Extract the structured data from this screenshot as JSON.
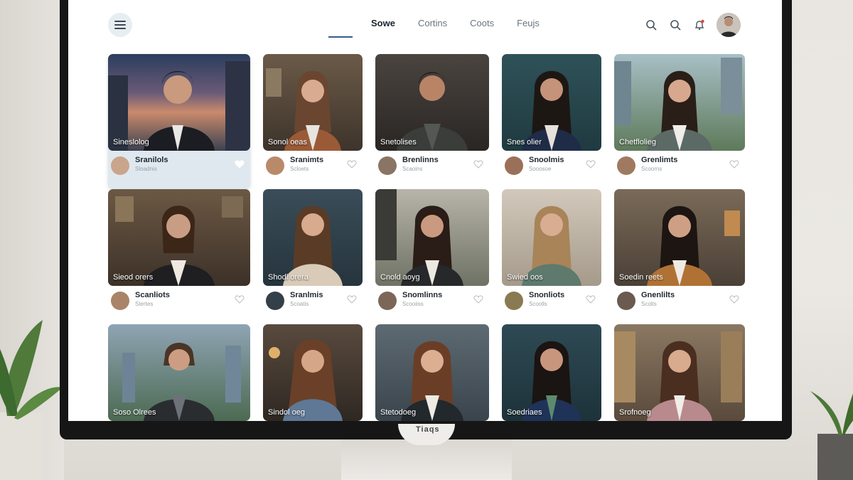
{
  "nav": {
    "tabs": [
      {
        "label": "Sowe",
        "active": true
      },
      {
        "label": "Cortins",
        "active": false
      },
      {
        "label": "Coots",
        "active": false
      },
      {
        "label": "Feujs",
        "active": false
      }
    ],
    "icons": [
      "search-icon",
      "search-icon",
      "bell-icon",
      "user-avatar"
    ]
  },
  "accent_color": "#385c8a",
  "brand": "Tiaqs",
  "rows": [
    [
      {
        "caption": "Sineslolog",
        "name": "Sranilols",
        "sub": "Sloadnis",
        "liked": true
      },
      {
        "caption": "Sonol oeas",
        "name": "Sranimts",
        "sub": "Scloets",
        "liked": false
      },
      {
        "caption": "Snetolises",
        "name": "Brenlinns",
        "sub": "Scaoins",
        "liked": false
      },
      {
        "caption": "Snes olier",
        "name": "Snoolmis",
        "sub": "Sooosoe",
        "liked": false
      },
      {
        "caption": "Chetflolieg",
        "name": "Grenlimts",
        "sub": "Scoorns",
        "liked": false
      }
    ],
    [
      {
        "caption": "Sieod orers",
        "name": "Scanliots",
        "sub": "Stertes",
        "liked": false
      },
      {
        "caption": "Shodl orera",
        "name": "Sranlmis",
        "sub": "Scoatis",
        "liked": false
      },
      {
        "caption": "Cnold aoyg",
        "name": "Snomlinns",
        "sub": "Scooiiss",
        "liked": false
      },
      {
        "caption": "Swied oos",
        "name": "Snonliots",
        "sub": "Scoolls",
        "liked": false
      },
      {
        "caption": "Soedin reets",
        "name": "Gnenlilts",
        "sub": "Scolts",
        "liked": false
      }
    ],
    [
      {
        "caption": "Soso Olrees",
        "name": "",
        "sub": "",
        "liked": false
      },
      {
        "caption": "Sindol oeg",
        "name": "",
        "sub": "",
        "liked": false
      },
      {
        "caption": "Stetodoeg",
        "name": "",
        "sub": "",
        "liked": false
      },
      {
        "caption": "Soedriaes",
        "name": "",
        "sub": "",
        "liked": false
      },
      {
        "caption": "Srofnoeg",
        "name": "",
        "sub": "",
        "liked": false
      }
    ]
  ]
}
